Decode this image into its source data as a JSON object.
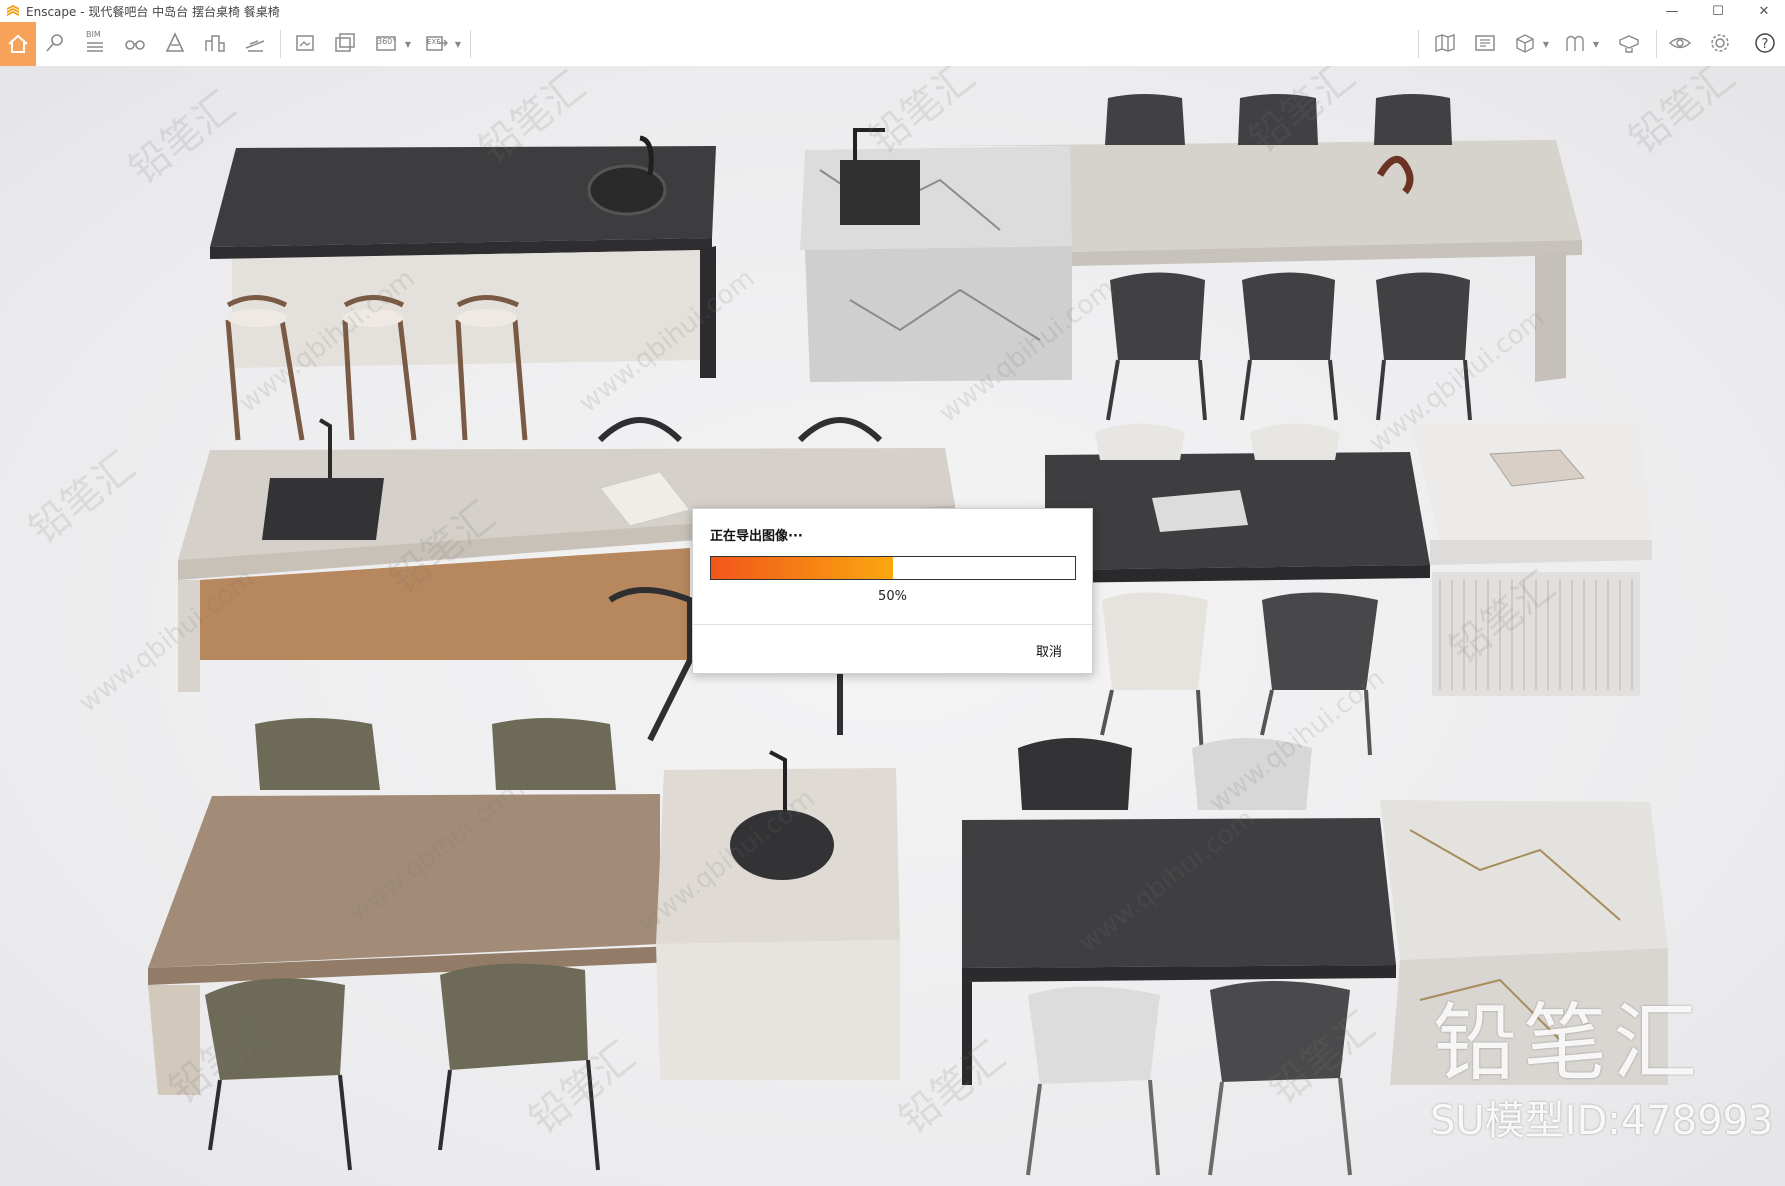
{
  "window": {
    "title": "Enscape - 现代餐吧台 中岛台 摆台桌椅 餐桌椅",
    "controls": [
      "—",
      "☐",
      "✕"
    ]
  },
  "toolbar": {
    "bim_label": "BIM",
    "pano_label": "360°",
    "exe_label": "EXE",
    "accent": "#f7a25b",
    "icons_left": [
      "home-icon",
      "pin-icon",
      "bim-icon",
      "binoculars-icon",
      "warning-cone-icon",
      "buildings-icon",
      "hat-icon",
      "render-image-icon",
      "batch-render-icon",
      "panorama-icon",
      "export-exe-icon"
    ],
    "icons_right": [
      "map-icon",
      "layout-icon",
      "cube-icon",
      "frames-icon",
      "presentation-icon",
      "eye-icon",
      "settings-gear-icon",
      "help-icon"
    ]
  },
  "dialog": {
    "title": "正在导出图像···",
    "progress_fraction": 0.5,
    "progress_text": "50%",
    "cancel_label": "取消",
    "fill_start_color": "#f1561b",
    "fill_end_color": "#fba80f"
  },
  "watermark": {
    "brand": "铅笔汇",
    "model_id": "SU模型ID:478993",
    "tiled_cn": "铅笔汇",
    "tiled_url": "www.qbihui.com"
  }
}
